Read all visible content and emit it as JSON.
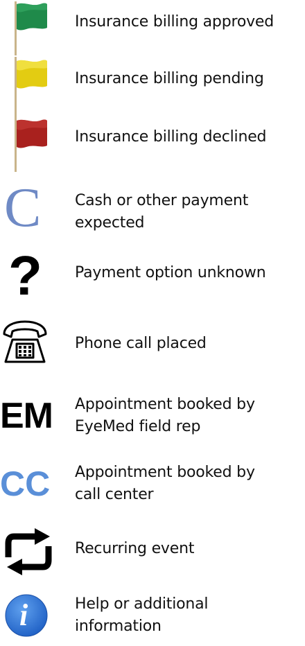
{
  "legend": {
    "items": [
      {
        "icon": "green-flag-icon",
        "color": "#1f8a4a",
        "label": "Insurance billing approved"
      },
      {
        "icon": "yellow-flag-icon",
        "color": "#e3cc12",
        "label": "Insurance billing pending"
      },
      {
        "icon": "red-flag-icon",
        "color": "#a9211e",
        "label": "Insurance billing declined"
      },
      {
        "icon": "cash-c-icon",
        "color": "#6f8ac5",
        "glyph": "C",
        "label": "Cash or other payment\nexpected"
      },
      {
        "icon": "question-mark-icon",
        "color": "#000000",
        "glyph": "?",
        "label": "Payment option unknown"
      },
      {
        "icon": "telephone-icon",
        "color": "#000000",
        "label": "Phone call placed"
      },
      {
        "icon": "em-icon",
        "color": "#000000",
        "glyph": "EM",
        "label": "Appointment booked by\nEyeMed field rep"
      },
      {
        "icon": "cc-icon",
        "color": "#5a8fd8",
        "glyph": "CC",
        "label": "Appointment booked by\ncall center"
      },
      {
        "icon": "recurring-icon",
        "color": "#000000",
        "label": "Recurring event"
      },
      {
        "icon": "info-icon",
        "color": "#2c6fd3",
        "glyph": "i",
        "label": "Help or additional\ninformation"
      }
    ]
  }
}
